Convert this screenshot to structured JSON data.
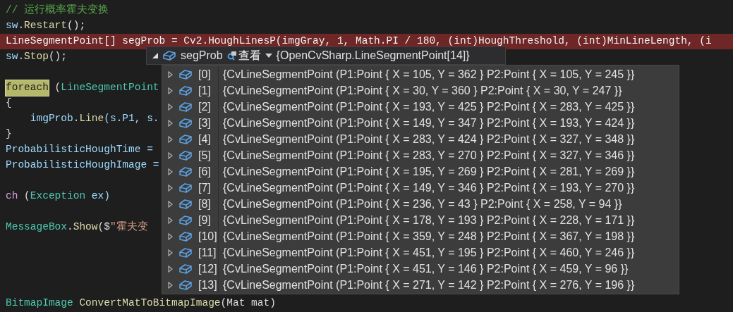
{
  "code_blocks": [
    {
      "lines": [
        {
          "tokens": [
            {
              "text": "// 运行概率霍夫变换",
              "kind": "comment"
            }
          ]
        },
        {
          "tokens": [
            {
              "text": "sw",
              "kind": "variable"
            },
            {
              "text": ".",
              "kind": "plain"
            },
            {
              "text": "Restart",
              "kind": "method"
            },
            {
              "text": "();",
              "kind": "plain"
            }
          ]
        },
        {
          "highlighted": true,
          "tokens": [
            {
              "text": "LineSegmentPoint[] segProb = Cv2.HoughLinesP(imgGray, 1, Math.PI / 180, (int)HoughThreshold, (int)MinLineLength, (i",
              "kind": "plain"
            }
          ]
        },
        {
          "tokens": [
            {
              "text": "sw",
              "kind": "variable"
            },
            {
              "text": ".",
              "kind": "plain"
            },
            {
              "text": "Stop",
              "kind": "method"
            },
            {
              "text": "();",
              "kind": "plain"
            }
          ]
        }
      ]
    },
    {
      "lines": [
        {
          "tokens": [
            {
              "text": "foreach",
              "kind": "reference"
            },
            {
              "text": " (",
              "kind": "plain"
            },
            {
              "text": "LineSegmentPoint",
              "kind": "type"
            }
          ]
        },
        {
          "tokens": [
            {
              "text": "{",
              "kind": "plain"
            }
          ]
        },
        {
          "tokens": [
            {
              "text": "    imgProb",
              "kind": "variable"
            },
            {
              "text": ".",
              "kind": "plain"
            },
            {
              "text": "Line",
              "kind": "method"
            },
            {
              "text": "(s.P1, s.",
              "kind": "variable"
            }
          ]
        },
        {
          "tokens": [
            {
              "text": "}",
              "kind": "plain"
            }
          ]
        },
        {
          "tokens": [
            {
              "text": "ProbabilisticHoughTime =",
              "kind": "variable"
            }
          ]
        },
        {
          "tokens": [
            {
              "text": "ProbabilisticHoughImage =",
              "kind": "variable"
            }
          ]
        }
      ]
    },
    {
      "lines": [
        {
          "tokens": [
            {
              "text": "ch",
              "kind": "keyword"
            },
            {
              "text": " (",
              "kind": "plain"
            },
            {
              "text": "Exception",
              "kind": "type"
            },
            {
              "text": " ex)",
              "kind": "variable"
            }
          ]
        }
      ]
    },
    {
      "lines": [
        {
          "tokens": [
            {
              "text": "MessageBox",
              "kind": "type"
            },
            {
              "text": ".",
              "kind": "plain"
            },
            {
              "text": "Show",
              "kind": "method"
            },
            {
              "text": "($",
              "kind": "plain"
            },
            {
              "text": "\"霍夫变",
              "kind": "string"
            }
          ]
        }
      ]
    },
    {
      "lines": [
        {
          "tokens": [
            {
              "text": "BitmapImage",
              "kind": "type"
            },
            {
              "text": "ConvertMatToBitmapImage",
              "kind": "method"
            },
            {
              "text": "(Mat mat)",
              "kind": "plain"
            }
          ]
        }
      ]
    }
  ],
  "datatip": {
    "expanded": true,
    "name": "segProb",
    "view_label": "查看",
    "value": "{OpenCvSharp.LineSegmentPoint[14]}",
    "items": [
      {
        "expanded": false,
        "index": "[0]",
        "value": "{CvLineSegmentPoint (P1:Point { X = 105, Y = 362 } P2:Point { X = 105, Y = 245 }}"
      },
      {
        "expanded": false,
        "index": "[1]",
        "value": "{CvLineSegmentPoint (P1:Point { X = 30, Y = 360 } P2:Point { X = 30, Y = 247 }}"
      },
      {
        "expanded": false,
        "index": "[2]",
        "value": "{CvLineSegmentPoint (P1:Point { X = 193, Y = 425 } P2:Point { X = 283, Y = 425 }}"
      },
      {
        "expanded": false,
        "index": "[3]",
        "value": "{CvLineSegmentPoint (P1:Point { X = 149, Y = 347 } P2:Point { X = 193, Y = 424 }}"
      },
      {
        "expanded": false,
        "index": "[4]",
        "value": "{CvLineSegmentPoint (P1:Point { X = 283, Y = 424 } P2:Point { X = 327, Y = 348 }}"
      },
      {
        "expanded": false,
        "index": "[5]",
        "value": "{CvLineSegmentPoint (P1:Point { X = 283, Y = 270 } P2:Point { X = 327, Y = 346 }}"
      },
      {
        "expanded": false,
        "index": "[6]",
        "value": "{CvLineSegmentPoint (P1:Point { X = 195, Y = 269 } P2:Point { X = 281, Y = 269 }}"
      },
      {
        "expanded": false,
        "index": "[7]",
        "value": "{CvLineSegmentPoint (P1:Point { X = 149, Y = 346 } P2:Point { X = 193, Y = 270 }}"
      },
      {
        "expanded": false,
        "index": "[8]",
        "value": "{CvLineSegmentPoint (P1:Point { X = 236, Y = 43 } P2:Point { X = 258, Y = 94 }}"
      },
      {
        "expanded": false,
        "index": "[9]",
        "value": "{CvLineSegmentPoint (P1:Point { X = 178, Y = 193 } P2:Point { X = 228, Y = 171 }}"
      },
      {
        "expanded": false,
        "index": "[10]",
        "value": "{CvLineSegmentPoint (P1:Point { X = 359, Y = 248 } P2:Point { X = 367, Y = 198 }}"
      },
      {
        "expanded": false,
        "index": "[11]",
        "value": "{CvLineSegmentPoint (P1:Point { X = 451, Y = 195 } P2:Point { X = 460, Y = 246 }}"
      },
      {
        "expanded": false,
        "index": "[12]",
        "value": "{CvLineSegmentPoint (P1:Point { X = 451, Y = 146 } P2:Point { X = 459, Y = 96 }}"
      },
      {
        "expanded": false,
        "index": "[13]",
        "value": "{CvLineSegmentPoint (P1:Point { X = 271, Y = 142 } P2:Point { X = 276, Y = 196 }}"
      }
    ]
  }
}
